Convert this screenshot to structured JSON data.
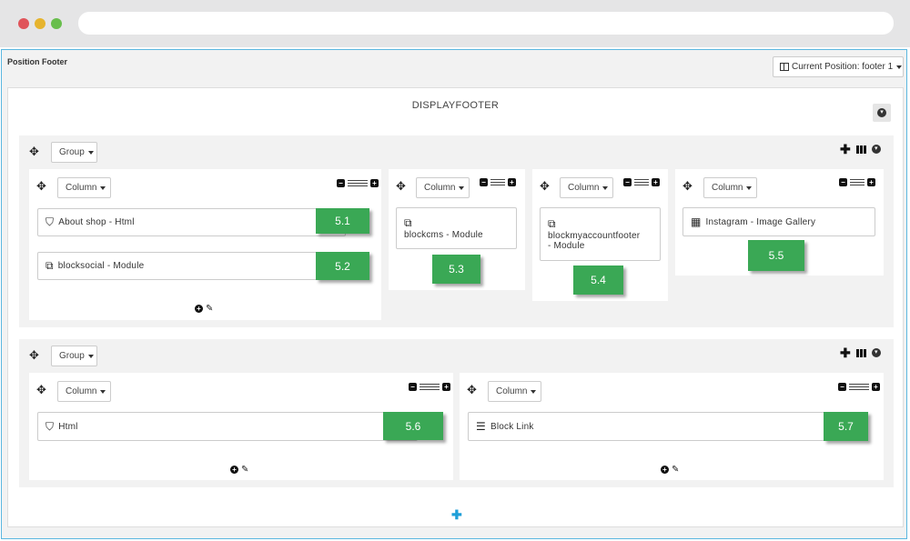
{
  "window": {
    "dots": [
      "#e0545a",
      "#e6b42e",
      "#68be4c"
    ]
  },
  "header": {
    "position_title": "Position Footer",
    "current_position": "Current Position: footer 1"
  },
  "display_title": "DISPLAYFOOTER",
  "labels": {
    "group": "Group",
    "column": "Column"
  },
  "colors": {
    "badge": "#3aa855",
    "accent": "#1f9fd8"
  },
  "modules": {
    "m1": {
      "label": "About shop - Html",
      "badge": "5.1",
      "icon": "html5-icon"
    },
    "m2": {
      "label": "blocksocial - Module",
      "badge": "5.2",
      "icon": "copy-icon"
    },
    "m3": {
      "label": "blockcms - Module",
      "badge": "5.3",
      "icon": "copy-icon"
    },
    "m4": {
      "label1": "blockmyaccountfooter",
      "label2": "- Module",
      "badge": "5.4",
      "icon": "copy-icon"
    },
    "m5": {
      "label": "Instagram - Image Gallery",
      "badge": "5.5",
      "icon": "grid-icon"
    },
    "m6": {
      "label": "Html",
      "badge": "5.6",
      "icon": "html5-icon"
    },
    "m7": {
      "label": "Block Link",
      "badge": "5.7",
      "icon": "list-icon"
    }
  }
}
